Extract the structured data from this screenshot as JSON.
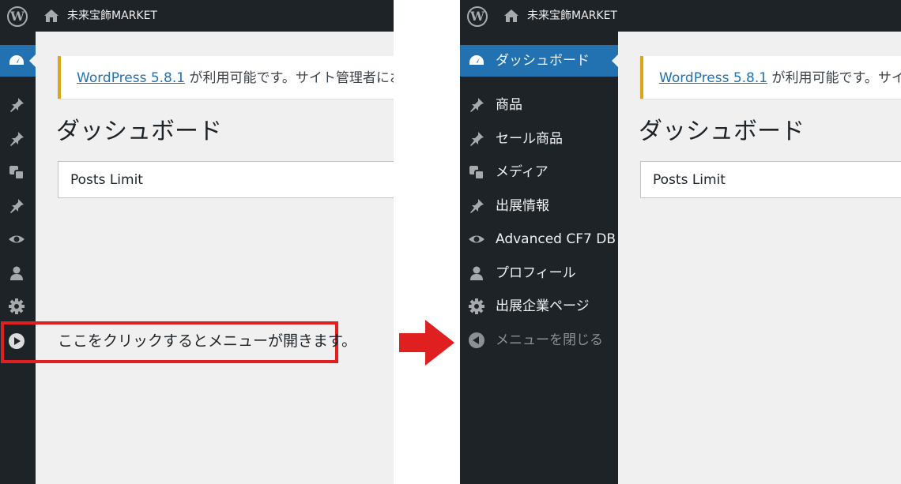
{
  "site_name": "未来宝飾MARKET",
  "notice": {
    "link_text": "WordPress 5.8.1",
    "text_left": "が利用可能です。サイト管理者にお",
    "text_right": "が利用可能です。サイト"
  },
  "page_title": "ダッシュボード",
  "postbox_title": "Posts Limit",
  "annotation": "ここをクリックするとメニューが開きます。",
  "menu": {
    "items": [
      {
        "label": "ダッシュボード",
        "icon": "dashboard-icon"
      },
      {
        "label": "商品",
        "icon": "pin-icon"
      },
      {
        "label": "セール商品",
        "icon": "pin-icon"
      },
      {
        "label": "メディア",
        "icon": "media-icon"
      },
      {
        "label": "出展情報",
        "icon": "pin-icon"
      },
      {
        "label": "Advanced CF7 DB",
        "icon": "eye-icon"
      },
      {
        "label": "プロフィール",
        "icon": "user-icon"
      },
      {
        "label": "出展企業ページ",
        "icon": "gear-icon"
      },
      {
        "label": "メニューを閉じる",
        "icon": "collapse-icon"
      }
    ]
  },
  "colors": {
    "adminbar": "#1d2327",
    "sidebar": "#1d2327",
    "active": "#2271b1",
    "notice_border": "#dba617",
    "link": "#2271b1",
    "highlight": "#e02020",
    "background": "#f0f0f1"
  }
}
